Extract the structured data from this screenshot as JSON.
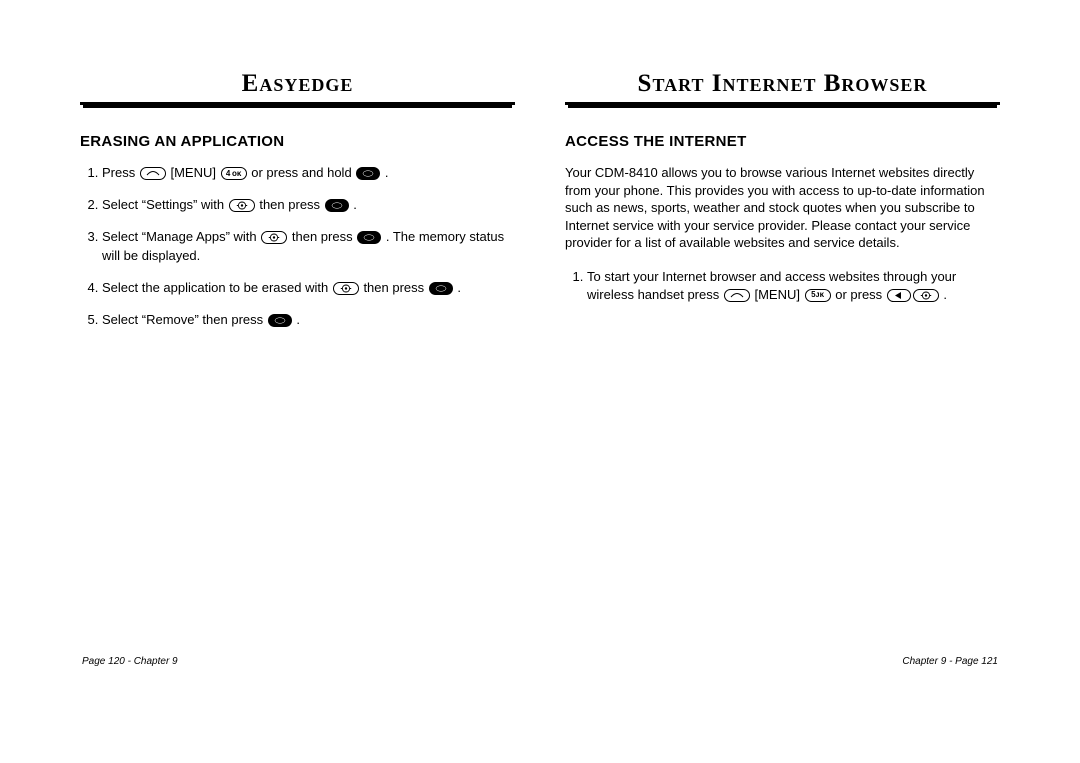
{
  "left": {
    "title": "Easyedge",
    "section": "ERASING AN APPLICATION",
    "steps": {
      "s1a": "Press ",
      "s1b": " [MENU] ",
      "s1c": "  or press and hold ",
      "s1d": " .",
      "s2a": "Select “Settings” with ",
      "s2b": " then press ",
      "s2c": " .",
      "s3a": "Select “Manage Apps” with ",
      "s3b": " then press ",
      "s3c": " . The memory status will be displayed.",
      "s4a": "Select the application to be erased with ",
      "s4b": " then press ",
      "s4c": " .",
      "s5a": "Select “Remove” then press ",
      "s5b": " ."
    },
    "footer": "Page 120 - Chapter 9"
  },
  "right": {
    "title": "Start Internet Browser",
    "section": "ACCESS THE INTERNET",
    "intro": "Your CDM-8410 allows you to browse various Internet websites directly from your phone. This provides you with access to up-to-date information such as news, sports, weather and stock quotes when you subscribe to Internet service with your service provider. Please contact your service provider for a list of available websites and service details.",
    "steps": {
      "s1a": "To start your Internet browser and access websites through your wireless handset press ",
      "s1b": " [MENU] ",
      "s1c": " or press ",
      "s1d": " ."
    },
    "footer": "Chapter 9 - Page 121"
  },
  "keylabels": {
    "softLeft": "",
    "key4": "4 ᴏᴋ",
    "key5": "5ᴊᴋ",
    "ok": ""
  }
}
